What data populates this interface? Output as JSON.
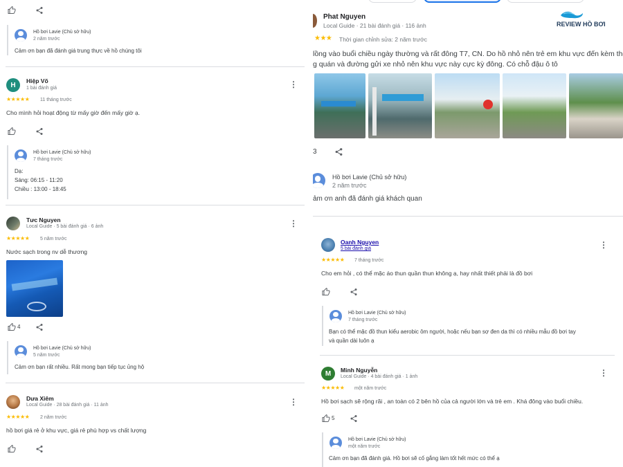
{
  "left": {
    "top_reply": {
      "owner": "Hồ bơi Lavie (Chủ sở hữu)",
      "time": "2 năm trước",
      "text": "Cảm ơn bạn đã đánh giá trung thực về hồ chúng tôi"
    },
    "review1": {
      "initial": "H",
      "name": "Hiệp Võ",
      "meta": "1 bài đánh giá",
      "stars": "★★★★★",
      "time": "11 tháng trước",
      "text": "Cho mình hỏi hoạt động từ mấy giờ đến mấy giờ ạ.",
      "reply": {
        "owner": "Hồ bơi Lavie (Chủ sở hữu)",
        "time": "7 tháng trước",
        "line1": "Dạ:",
        "line2": "Sáng: 06:15 - 11:20",
        "line3": "Chiều : 13:00 - 18:45"
      }
    },
    "review2": {
      "name": "Tưc Nguyen",
      "meta": "Local Guide · 5 bài đánh giá · 6 ảnh",
      "stars": "★★★★★",
      "time": "5 năm trước",
      "text": "Nước sạch trong nv dễ thương",
      "likes": "4",
      "reply": {
        "owner": "Hồ bơi Lavie (Chủ sở hữu)",
        "time": "5 năm trước",
        "text": "Cảm ơn bạn rất nhiều. Rất mong bạn tiếp tục ủng hộ"
      }
    },
    "review3": {
      "name": "Dưa Xiêm",
      "meta": "Local Guide · 28 bài đánh giá · 11 ảnh",
      "stars": "★★★★★",
      "time": "2 năm trước",
      "text": "hồ bơi giá rẻ ở khu vực, giá rẻ phù hợp vs chất lượng"
    }
  },
  "right": {
    "review_top": {
      "name": "Phat Nguyen",
      "meta": "Local Guide · 21 bài đánh giá · 116 ảnh",
      "stars": "★★★",
      "edited": "Thời gian chỉnh sửa: 2 năm trước",
      "line1": "lồng vào buổi chiều ngày thường và rất đông T7, CN. Do hồ nhỏ nên trẻ em khu vực đến kèm the",
      "line2": "g quán và đường gửi xe nhỏ nên khu vực này cực kỳ đông. Có chỗ đậu ô tô",
      "like_partial": "3",
      "reply": {
        "owner": "Hồ bơi Lavie (Chủ sở hữu)",
        "time": "2 năm trước",
        "text": "ảm ơn anh đã đánh giá khách quan"
      }
    },
    "logo": "REVIEW HỒ BƠI",
    "review_oanh": {
      "name": "Oanh Nguyen",
      "meta": "5 bài đánh giá",
      "stars": "★★★★★",
      "time": "7 tháng trước",
      "text": "Cho em hỏi , có thể mặc áo thun quần thun không ạ, hay nhất thiết phải là đồ bơi",
      "reply": {
        "owner": "Hồ bơi Lavie (Chủ sở hữu)",
        "time": "7 tháng trước",
        "line1": "Bạn có thể mặc đồ thun kiểu aerobic ôm người, hoặc nếu bạn sợ đen da thì có nhiều mẫu đồ bơi tay",
        "line2": "và quần dài luôn ạ"
      }
    },
    "review_minh": {
      "initial": "M",
      "name": "Minh Nguyễn",
      "meta": "Local Guide · 4 bài đánh giá · 1 ảnh",
      "stars": "★★★★★",
      "time": "một năm trước",
      "text": "Hồ bơi sạch sẽ rộng rãi , an toàn có 2 bên hồ của cả người lớn và trẻ em . Khá đông vào buổi chiều.",
      "likes": "5",
      "reply": {
        "owner": "Hồ bơi Lavie (Chủ sở hữu)",
        "time": "một năm trước",
        "text": "Cảm ơn bạn đã đánh giá. Hồ bơi sẽ cố gắng làm tốt hết mức có thể ạ"
      }
    }
  },
  "icons": {
    "like": "thumb-up-icon",
    "share": "share-icon",
    "more": "more-vert-icon"
  },
  "colors": {
    "star": "#fbbc04",
    "owner_avatar": "#5b8ddb",
    "avatar_h": "#1e8e7e",
    "avatar_m": "#2e7d32",
    "link": "#1a0dab"
  }
}
